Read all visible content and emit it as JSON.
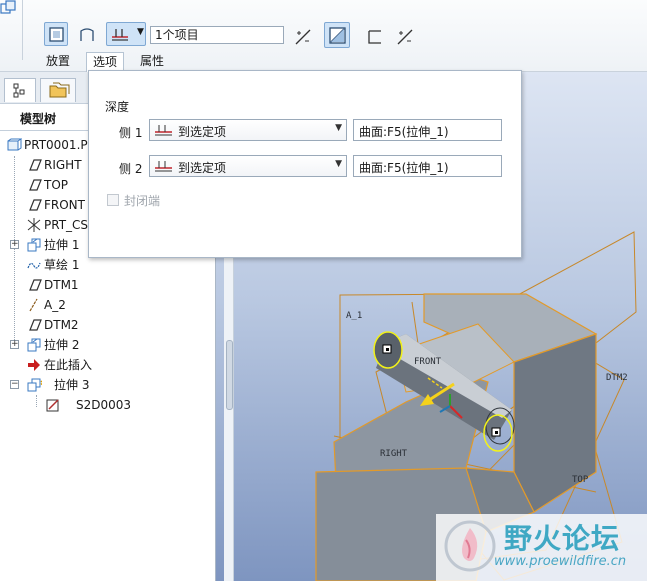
{
  "toolbar": {
    "collector_value": "1个项目",
    "tabs": [
      {
        "label": "放置"
      },
      {
        "label": "选项"
      },
      {
        "label": "属性"
      }
    ]
  },
  "options_panel": {
    "depth_title": "深度",
    "side1": {
      "label": "侧 1",
      "depth_option": "到选定项",
      "reference": "曲面:F5(拉伸_1)"
    },
    "side2": {
      "label": "侧 2",
      "depth_option": "到选定项",
      "reference": "曲面:F5(拉伸_1)"
    },
    "capped_ends": {
      "label": "封闭端",
      "checked": false,
      "enabled": false
    }
  },
  "model_tree": {
    "title": "模型树",
    "items": [
      {
        "label": "PRT0001.P",
        "icon": "part-icon"
      },
      {
        "label": "RIGHT",
        "icon": "datum-plane-icon"
      },
      {
        "label": "TOP",
        "icon": "datum-plane-icon"
      },
      {
        "label": "FRONT",
        "icon": "datum-plane-icon"
      },
      {
        "label": "PRT_CS",
        "icon": "coordinate-system-icon"
      },
      {
        "label": "拉伸 1",
        "icon": "extrude-icon"
      },
      {
        "label": "草绘 1",
        "icon": "sketch-icon"
      },
      {
        "label": "DTM1",
        "icon": "datum-plane-icon"
      },
      {
        "label": "A_2",
        "icon": "datum-axis-icon"
      },
      {
        "label": "DTM2",
        "icon": "datum-plane-icon"
      },
      {
        "label": "拉伸 2",
        "icon": "extrude-icon"
      },
      {
        "label": "在此插入",
        "icon": "insert-here-arrow-icon"
      },
      {
        "label": "拉伸 3",
        "icon": "extrude-icon"
      },
      {
        "label": "S2D0003",
        "icon": "section-sketch-icon"
      }
    ]
  },
  "viewport": {
    "labels": {
      "a1": "A_1",
      "front": "FRONT",
      "right": "RIGHT",
      "top": "TOP",
      "dtm2": "DTM2"
    }
  },
  "watermark": {
    "title": "野火论坛",
    "url": "www.proewildfire.cn"
  },
  "colors": {
    "accent": "#cfe3f7",
    "datum_plane": "#c7882a",
    "selection_yellow": "#f2f21a",
    "model_gray": "#9aa3ad"
  }
}
